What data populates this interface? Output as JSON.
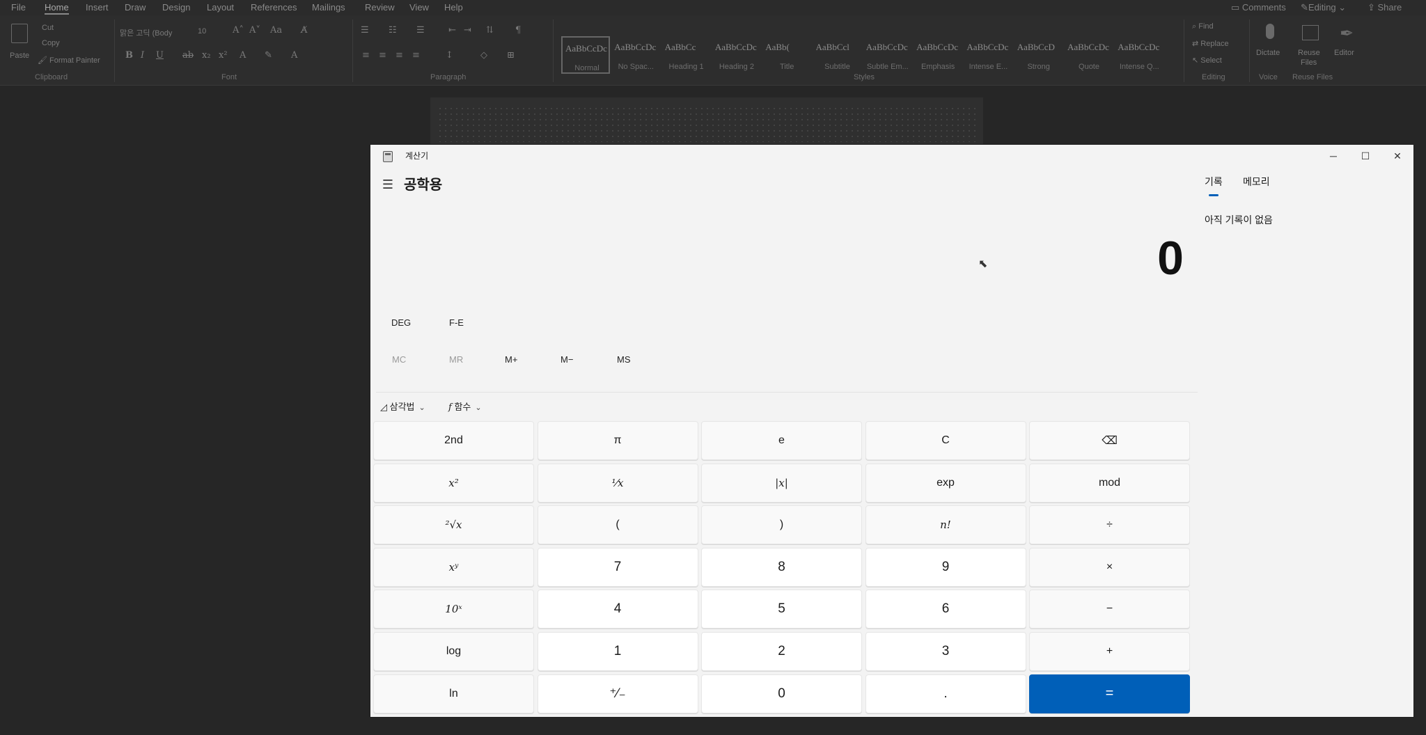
{
  "word": {
    "menu": [
      "File",
      "Home",
      "Insert",
      "Draw",
      "Design",
      "Layout",
      "References",
      "Mailings",
      "Review",
      "View",
      "Help"
    ],
    "menu_right": {
      "comments": "Comments",
      "editing": "Editing",
      "share": "Share"
    },
    "clipboard": {
      "paste": "Paste",
      "cut": "Cut",
      "copy": "Copy",
      "format_painter": "Format Painter",
      "label": "Clipboard"
    },
    "font": {
      "name": "맑은 고딕 (Body",
      "size": "10",
      "label": "Font"
    },
    "paragraph_label": "Paragraph",
    "styles": [
      {
        "sample": "AaBbCcDc",
        "name": "Normal"
      },
      {
        "sample": "AaBbCcDc",
        "name": "No Spac..."
      },
      {
        "sample": "AaBbCc",
        "name": "Heading 1"
      },
      {
        "sample": "AaBbCcDc",
        "name": "Heading 2"
      },
      {
        "sample": "AaBb(",
        "name": "Title"
      },
      {
        "sample": "AaBbCcl",
        "name": "Subtitle"
      },
      {
        "sample": "AaBbCcDc",
        "name": "Subtle Em..."
      },
      {
        "sample": "AaBbCcDc",
        "name": "Emphasis"
      },
      {
        "sample": "AaBbCcDc",
        "name": "Intense E..."
      },
      {
        "sample": "AaBbCcD",
        "name": "Strong"
      },
      {
        "sample": "AaBbCcDc",
        "name": "Quote"
      },
      {
        "sample": "AaBbCcDc",
        "name": "Intense Q..."
      }
    ],
    "styles_label": "Styles",
    "editing": {
      "find": "Find",
      "replace": "Replace",
      "select": "Select",
      "label": "Editing"
    },
    "voice": {
      "dictate": "Dictate",
      "label": "Voice"
    },
    "reuse": {
      "label_1": "Reuse",
      "label_2": "Files",
      "group": "Reuse Files"
    },
    "editor": "Editor"
  },
  "calculator": {
    "window_title": "계산기",
    "mode_title": "공학용",
    "display": "0",
    "angle_mode": "DEG",
    "fe": "F-E",
    "memory": {
      "mc": "MC",
      "mr": "MR",
      "mplus": "M+",
      "mminus": "M−",
      "ms": "MS"
    },
    "trig_label": "삼각법",
    "func_label": "함수",
    "keys": [
      [
        "2nd",
        "π",
        "e",
        "C",
        "⌫"
      ],
      [
        "x²",
        "¹⁄x",
        "|x|",
        "exp",
        "mod"
      ],
      [
        "²√x",
        "(",
        ")",
        "n!",
        "÷"
      ],
      [
        "xʸ",
        "7",
        "8",
        "9",
        "×"
      ],
      [
        "10ˣ",
        "4",
        "5",
        "6",
        "−"
      ],
      [
        "log",
        "1",
        "2",
        "3",
        "+"
      ],
      [
        "ln",
        "⁺⁄₋",
        "0",
        ".",
        "="
      ]
    ],
    "tabs": {
      "history": "기록",
      "memory": "메모리"
    },
    "history_empty": "아직 기록이 없음"
  }
}
